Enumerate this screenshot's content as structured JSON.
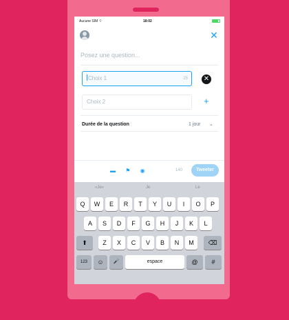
{
  "status": {
    "carrier": "Aucune SIM ⌔",
    "time": "18:02"
  },
  "compose": {
    "avatar_icon": "profile-avatar",
    "close_icon": "close",
    "question_placeholder": "Posez une question...",
    "choices": [
      {
        "placeholder": "Choix 1",
        "counter": "25"
      },
      {
        "placeholder": "Choix 2"
      }
    ],
    "add_icon": "+",
    "remove_icon": "✕",
    "duration_label": "Durée de la question",
    "duration_value": "1 jour",
    "char_count": "140",
    "tweet_button": "Tweeter"
  },
  "keyboard": {
    "predictions": [
      "«Je»",
      "Je",
      "Le"
    ],
    "row1": [
      "Q",
      "W",
      "E",
      "R",
      "T",
      "Y",
      "U",
      "I",
      "O",
      "P"
    ],
    "row2": [
      "A",
      "S",
      "D",
      "F",
      "G",
      "H",
      "J",
      "K",
      "L"
    ],
    "row3": [
      "Z",
      "X",
      "C",
      "V",
      "B",
      "N",
      "M"
    ],
    "shift": "⬆",
    "backspace": "⌫",
    "numbers": "123",
    "emoji": "☺",
    "mic": "🎤",
    "space": "espace",
    "at": "@",
    "hash": "#"
  },
  "colors": {
    "accent": "#1da1f2",
    "brand": "#e0245e"
  }
}
